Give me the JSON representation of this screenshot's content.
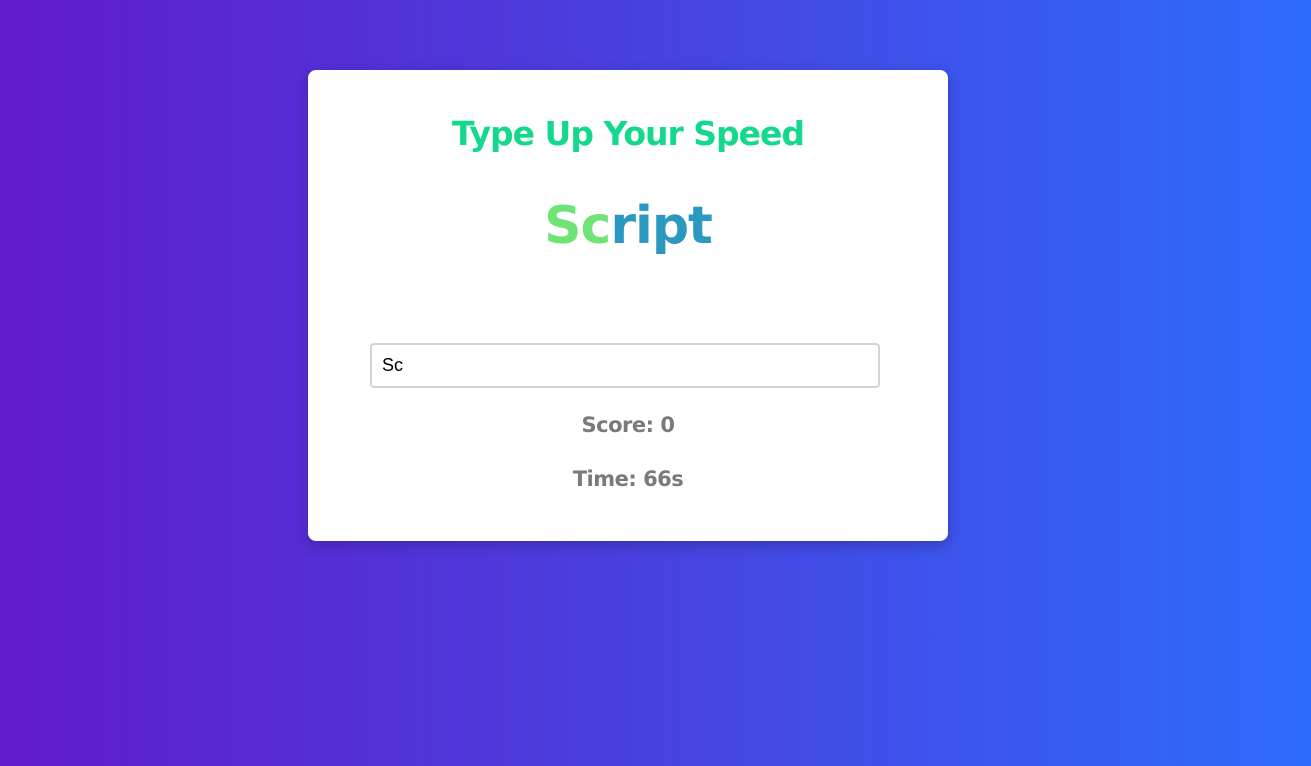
{
  "app": {
    "title": "Type Up Your Speed"
  },
  "current_word": {
    "typed_part": "Sc",
    "remaining_part": "ript"
  },
  "input": {
    "value": "Sc",
    "placeholder": ""
  },
  "stats": {
    "score_label": "Score: ",
    "score_value": "0",
    "time_label": "Time: ",
    "time_value": "66",
    "time_unit": "s"
  },
  "colors": {
    "background_start": "#621bcc",
    "background_end": "#2d6bfa",
    "title": "#14d98c",
    "typed_letters": "#6ee476",
    "remaining_letters": "#2b98c0",
    "stats_text": "#7a7a7a"
  }
}
